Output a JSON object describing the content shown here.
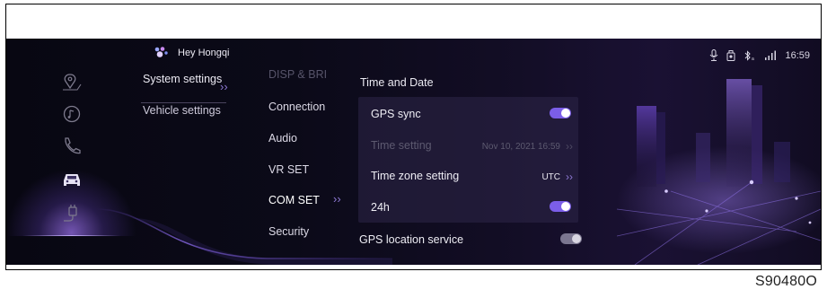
{
  "header": {
    "assistant_label": "Hey Hongqi",
    "time": "16:59"
  },
  "categories": [
    {
      "label": "System settings",
      "active": true
    },
    {
      "label": "Vehicle settings",
      "active": false
    }
  ],
  "submenu": [
    {
      "label": "DISP & BRI",
      "state": "dim"
    },
    {
      "label": "Connection",
      "state": "normal"
    },
    {
      "label": "Audio",
      "state": "normal"
    },
    {
      "label": "VR SET",
      "state": "normal"
    },
    {
      "label": "COM SET",
      "state": "active"
    },
    {
      "label": "Security",
      "state": "normal"
    }
  ],
  "content": {
    "section_title": "Time and Date",
    "rows": {
      "gps_sync": {
        "label": "GPS sync",
        "toggle": "on"
      },
      "time_setting": {
        "label": "Time setting",
        "value": "Nov 10, 2021 16:59",
        "disabled": true
      },
      "time_zone": {
        "label": "Time zone setting",
        "value": "UTC"
      },
      "format_24h": {
        "label": "24h",
        "toggle": "on"
      },
      "gps_location": {
        "label": "GPS location service",
        "toggle": "on"
      }
    }
  },
  "figure_code": "S90480O",
  "colors": {
    "accent": "#7b5ee8",
    "background": "#0b0a18",
    "panel": "#2d2648"
  },
  "icons": [
    "hongqi-logo-icon",
    "microphone-icon",
    "recorder-icon",
    "bluetooth-icon",
    "signal-icon",
    "navigation-icon",
    "media-icon",
    "phone-icon",
    "car-icon",
    "charging-icon",
    "chevron-right-icon"
  ]
}
